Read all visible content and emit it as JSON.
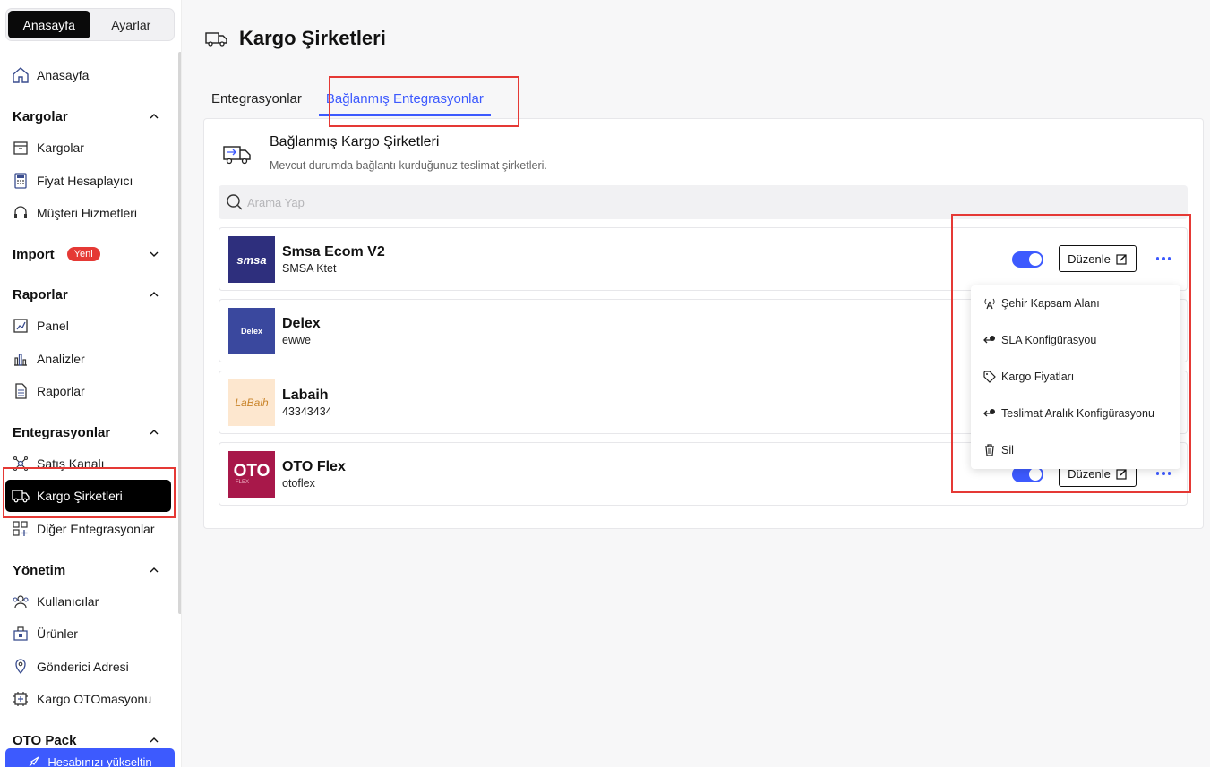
{
  "top_toggle": {
    "home": "Anasayfa",
    "settings": "Ayarlar"
  },
  "sidebar": {
    "home": "Anasayfa",
    "sections": {
      "kargolar": "Kargolar",
      "import": "Import",
      "import_badge": "Yeni",
      "raporlar": "Raporlar",
      "entegrasyonlar": "Entegrasyonlar",
      "yonetim": "Yönetim",
      "otopack": "OTO Pack"
    },
    "items": {
      "kargolar": "Kargolar",
      "fiyat": "Fiyat Hesaplayıcı",
      "musteri": "Müşteri Hizmetleri",
      "panel": "Panel",
      "analizler": "Analizler",
      "raporlar": "Raporlar",
      "satis": "Satış Kanalı",
      "kargo_sirketleri": "Kargo Şirketleri",
      "diger": "Diğer Entegrasyonlar",
      "kullanicilar": "Kullanıcılar",
      "urunler": "Ürünler",
      "gonderici": "Gönderici Adresi",
      "otomasyon": "Kargo OTOmasyonu"
    },
    "upgrade": "Hesabınızı yükseltin"
  },
  "page": {
    "title": "Kargo Şirketleri"
  },
  "tabs": {
    "integrations": "Entegrasyonlar",
    "connected": "Bağlanmış Entegrasyonlar"
  },
  "card": {
    "title": "Bağlanmış Kargo Şirketleri",
    "subtitle": "Mevcut durumda bağlantı kurduğunuz teslimat şirketleri.",
    "search_placeholder": "Arama Yap"
  },
  "carriers": [
    {
      "name": "Smsa Ecom V2",
      "sub": "SMSA Ktet",
      "logo_text": "smsa",
      "enabled": true
    },
    {
      "name": "Delex",
      "sub": "ewwe",
      "logo_text": "Delex",
      "enabled": true
    },
    {
      "name": "Labaih",
      "sub": "43343434",
      "logo_text": "LaBaih",
      "enabled": true
    },
    {
      "name": "OTO Flex",
      "sub": "otoflex",
      "logo_text": "OTO",
      "logo_sub": "FLEX",
      "enabled": true
    }
  ],
  "edit_label": "Düzenle",
  "menu": {
    "city": "Şehir Kapsam Alanı",
    "sla": "SLA Konfigürasyou",
    "prices": "Kargo Fiyatları",
    "delivery": "Teslimat Aralık Konfigürasyonu",
    "delete": "Sil"
  },
  "colors": {
    "accent": "#3d5afe",
    "highlight": "#e53935",
    "active_bg": "#000000"
  }
}
